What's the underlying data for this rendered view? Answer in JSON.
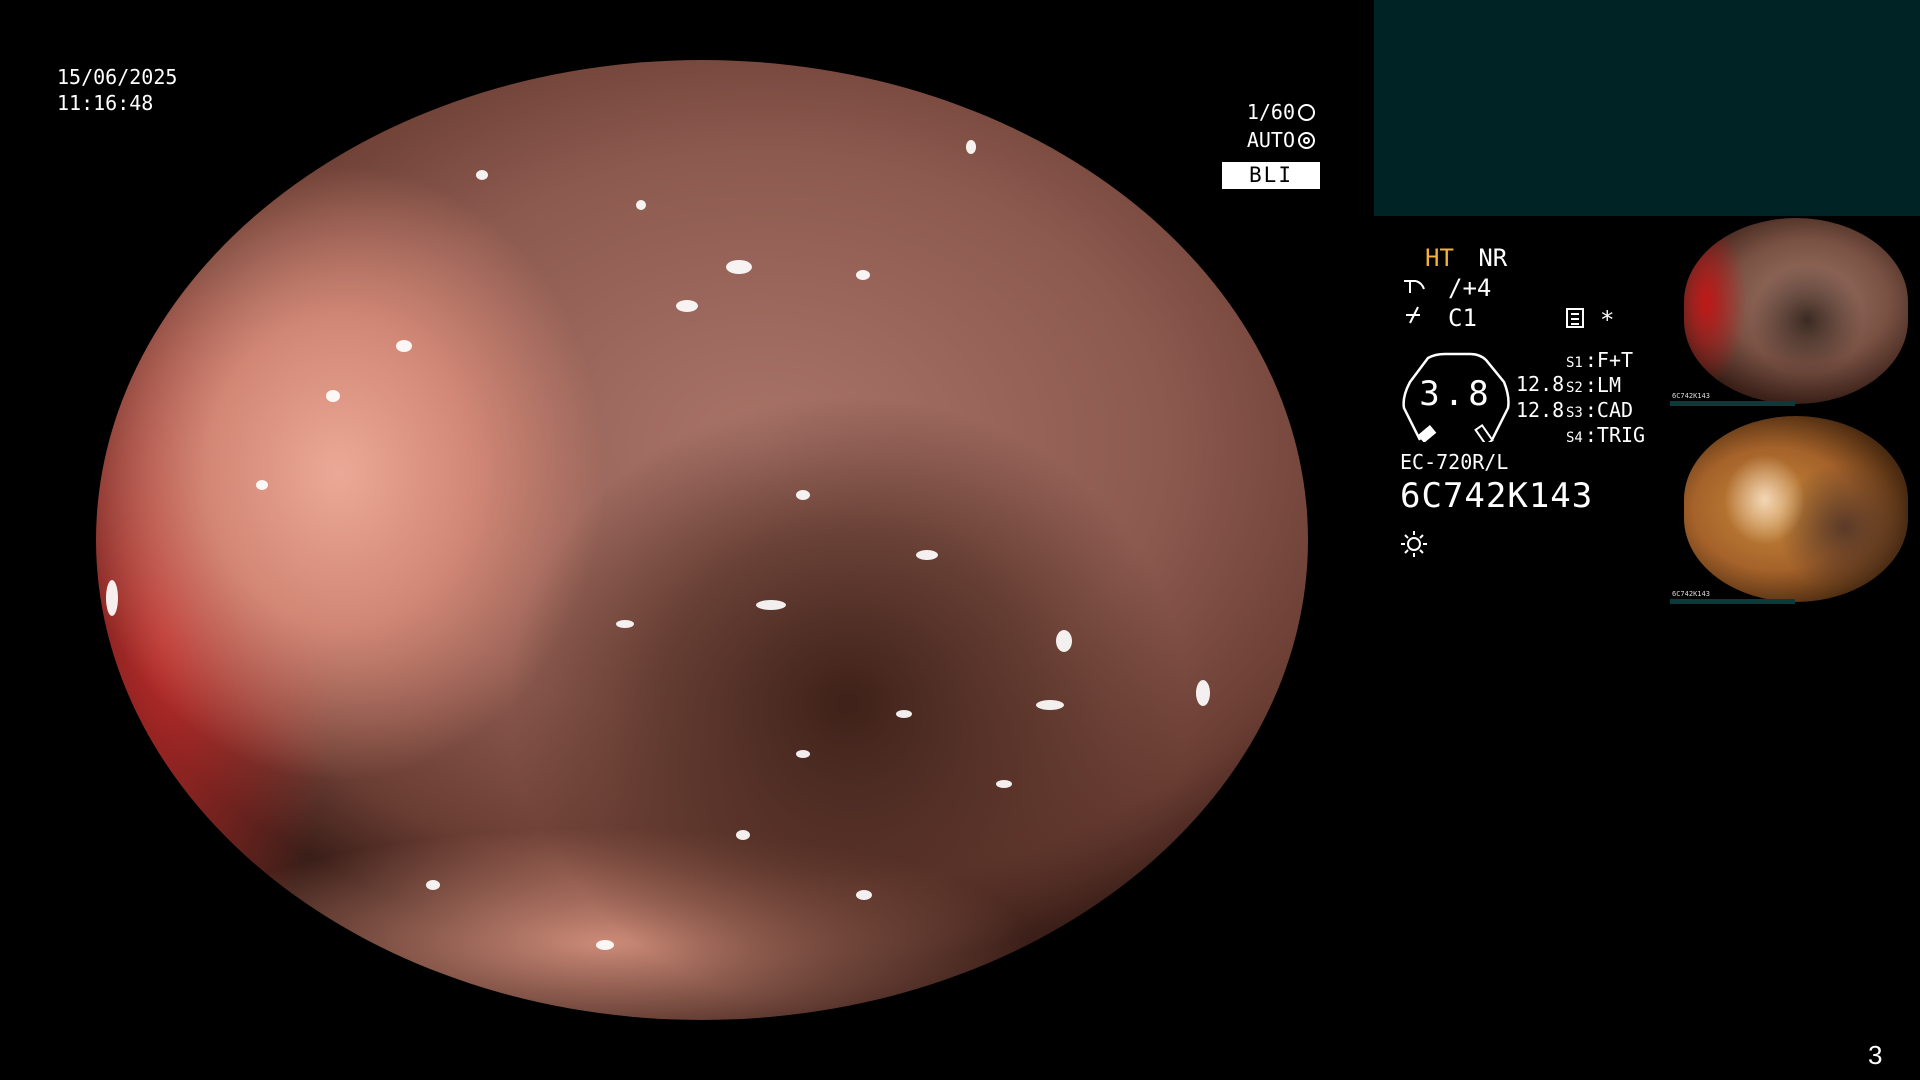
{
  "overlay": {
    "date": "15/06/2025",
    "time": "11:16:48",
    "shutter": "1/60",
    "exposure": "AUTO",
    "mode": "BLI",
    "shutter_icon": "aperture-icon",
    "exposure_icon": "iris-icon"
  },
  "panel": {
    "ht": "HT",
    "nr": "NR",
    "enhance_value": "/+4",
    "color_value": "C1",
    "asterisk": "*",
    "gauge_value": "3.8",
    "value_a": "12.8",
    "value_b": "12.8",
    "switches": [
      {
        "key": "S1",
        "label": "F+T"
      },
      {
        "key": "S2",
        "label": "LM"
      },
      {
        "key": "S3",
        "label": "CAD"
      },
      {
        "key": "S4",
        "label": "TRIG"
      }
    ],
    "model": "EC-720R/L",
    "serial": "6C742K143"
  },
  "thumbnails": [
    {
      "id": "1",
      "serial": "6C742K143"
    },
    {
      "id": "2",
      "serial": "6C742K143"
    }
  ],
  "page_number": "3",
  "colors": {
    "accent_ht": "#f2b23a",
    "panel_bg": "#002426",
    "background": "#000000"
  }
}
